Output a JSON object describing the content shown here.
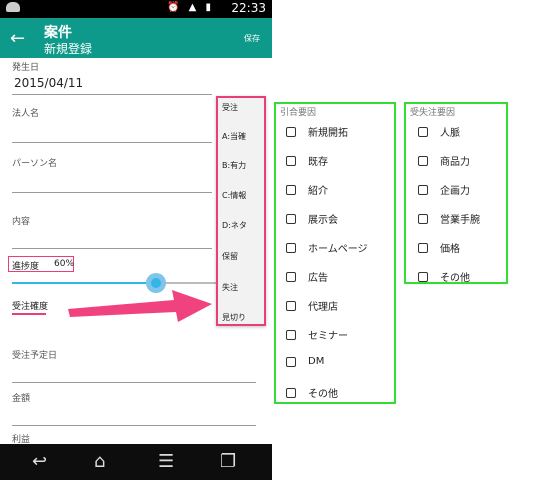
{
  "status_bar": {
    "time": "22:33"
  },
  "app_bar": {
    "title": "案件",
    "subtitle": "新規登録",
    "save_label": "保存"
  },
  "form": {
    "occurrence_date": {
      "label": "発生日",
      "value": "2015/04/11"
    },
    "corporate_name": {
      "label": "法人名"
    },
    "person_name": {
      "label": "パーソン名"
    },
    "content": {
      "label": "内容"
    },
    "progress": {
      "label": "進捗度",
      "value": "60%",
      "slider_level": 0.6
    },
    "order_certainty": {
      "label": "受注確度"
    },
    "order_date": {
      "label": "受注予定日"
    },
    "amount": {
      "label": "金額"
    },
    "profit": {
      "label": "利益"
    }
  },
  "status_dropdown": {
    "options": [
      "受注",
      "A:当確",
      "B:有力",
      "C:情報",
      "D:ネタ",
      "保留",
      "失注",
      "見切り"
    ]
  },
  "inquiry_panel": {
    "title": "引合要因",
    "items": [
      "新規開拓",
      "既存",
      "紹介",
      "展示会",
      "ホームページ",
      "広告",
      "代理店",
      "セミナー",
      "DM",
      "その他"
    ]
  },
  "loss_panel": {
    "title": "受失注要因",
    "items": [
      "人脈",
      "商品力",
      "企画力",
      "営業手腕",
      "価格",
      "その他"
    ]
  },
  "colors": {
    "accent": "#0e9a8a",
    "highlight": "#e83e7a",
    "panel_border": "#33dd33",
    "slider": "#33b5e5"
  },
  "nav_icons": [
    "back-icon",
    "home-icon",
    "menu-icon",
    "recent-apps-icon"
  ]
}
